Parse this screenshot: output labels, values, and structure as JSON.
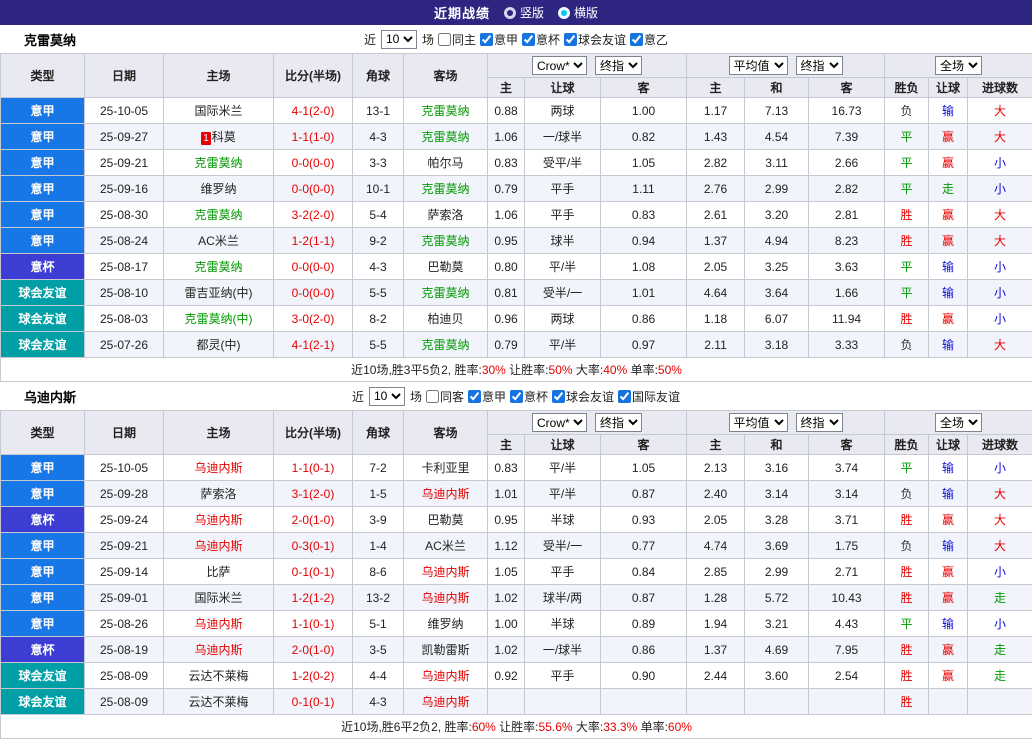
{
  "top_bar": {
    "title": "近期战绩",
    "options": [
      {
        "label": "竖版",
        "selected": false
      },
      {
        "label": "横版",
        "selected": true
      }
    ]
  },
  "table_headers": {
    "cols": [
      "类型",
      "日期",
      "主场",
      "比分(半场)",
      "角球",
      "客场"
    ],
    "groups": [
      {
        "selects": [
          "Crow*",
          "终指"
        ]
      },
      {
        "selects": [
          "平均值",
          "终指"
        ]
      },
      {
        "selects": [
          "全场"
        ]
      }
    ],
    "subs": [
      "主",
      "让球",
      "客",
      "主",
      "和",
      "客",
      "胜负",
      "让球",
      "进球数"
    ]
  },
  "league_colors": {
    "意甲": "#1777e6",
    "意杯": "#3d3dd3",
    "球会友谊": "#009ea5"
  },
  "result_colors": {
    "red": "#e60000",
    "green": "#009900",
    "blue": "#0b0bd6",
    "dark": "#333333"
  },
  "result_keys": {
    "胜": "red",
    "赢": "red",
    "大": "red",
    "平": "green",
    "走": "green",
    "负": "dark",
    "输": "blue",
    "小": "blue"
  },
  "text_colors": {
    "score": "#e60000",
    "opponent": "#222222"
  },
  "tables": [
    {
      "team": "克雷莫纳",
      "team_color": "#009900",
      "filter": {
        "near_label": "近",
        "count": "10",
        "games_label": "场",
        "checks": [
          {
            "label": "同主",
            "checked": false
          },
          {
            "label": "意甲",
            "checked": true
          },
          {
            "label": "意杯",
            "checked": true
          },
          {
            "label": "球会友谊",
            "checked": true
          },
          {
            "label": "意乙",
            "checked": true
          }
        ]
      },
      "rows": [
        {
          "type": "意甲",
          "date": "25-10-05",
          "home": {
            "name": "国际米兰"
          },
          "score": "4-1(2-0)",
          "corners": "13-1",
          "away": {
            "name": "克雷莫纳",
            "self": true
          },
          "odds": [
            "0.88",
            "两球",
            "1.00"
          ],
          "avg": [
            "1.17",
            "7.13",
            "16.73"
          ],
          "results": [
            "负",
            "输",
            "大"
          ]
        },
        {
          "type": "意甲",
          "date": "25-09-27",
          "home": {
            "name": "科莫",
            "badge": "1"
          },
          "score": "1-1(1-0)",
          "corners": "4-3",
          "away": {
            "name": "克雷莫纳",
            "self": true
          },
          "odds": [
            "1.06",
            "一/球半",
            "0.82"
          ],
          "avg": [
            "1.43",
            "4.54",
            "7.39"
          ],
          "results": [
            "平",
            "赢",
            "大"
          ]
        },
        {
          "type": "意甲",
          "date": "25-09-21",
          "home": {
            "name": "克雷莫纳",
            "self": true
          },
          "score": "0-0(0-0)",
          "corners": "3-3",
          "away": {
            "name": "帕尔马"
          },
          "odds": [
            "0.83",
            "受平/半",
            "1.05"
          ],
          "avg": [
            "2.82",
            "3.11",
            "2.66"
          ],
          "results": [
            "平",
            "赢",
            "小"
          ]
        },
        {
          "type": "意甲",
          "date": "25-09-16",
          "home": {
            "name": "维罗纳"
          },
          "score": "0-0(0-0)",
          "corners": "10-1",
          "away": {
            "name": "克雷莫纳",
            "self": true
          },
          "odds": [
            "0.79",
            "平手",
            "1.11"
          ],
          "avg": [
            "2.76",
            "2.99",
            "2.82"
          ],
          "results": [
            "平",
            "走",
            "小"
          ]
        },
        {
          "type": "意甲",
          "date": "25-08-30",
          "home": {
            "name": "克雷莫纳",
            "self": true
          },
          "score": "3-2(2-0)",
          "corners": "5-4",
          "away": {
            "name": "萨索洛"
          },
          "odds": [
            "1.06",
            "平手",
            "0.83"
          ],
          "avg": [
            "2.61",
            "3.20",
            "2.81"
          ],
          "results": [
            "胜",
            "赢",
            "大"
          ]
        },
        {
          "type": "意甲",
          "date": "25-08-24",
          "home": {
            "name": "AC米兰"
          },
          "score": "1-2(1-1)",
          "corners": "9-2",
          "away": {
            "name": "克雷莫纳",
            "self": true
          },
          "odds": [
            "0.95",
            "球半",
            "0.94"
          ],
          "avg": [
            "1.37",
            "4.94",
            "8.23"
          ],
          "results": [
            "胜",
            "赢",
            "大"
          ]
        },
        {
          "type": "意杯",
          "date": "25-08-17",
          "home": {
            "name": "克雷莫纳",
            "self": true
          },
          "score": "0-0(0-0)",
          "corners": "4-3",
          "away": {
            "name": "巴勒莫"
          },
          "odds": [
            "0.80",
            "平/半",
            "1.08"
          ],
          "avg": [
            "2.05",
            "3.25",
            "3.63"
          ],
          "results": [
            "平",
            "输",
            "小"
          ]
        },
        {
          "type": "球会友谊",
          "date": "25-08-10",
          "home": {
            "name": "雷吉亚纳(中)"
          },
          "score": "0-0(0-0)",
          "corners": "5-5",
          "away": {
            "name": "克雷莫纳",
            "self": true
          },
          "odds": [
            "0.81",
            "受半/一",
            "1.01"
          ],
          "avg": [
            "4.64",
            "3.64",
            "1.66"
          ],
          "results": [
            "平",
            "输",
            "小"
          ]
        },
        {
          "type": "球会友谊",
          "date": "25-08-03",
          "home": {
            "name": "克雷莫纳(中)",
            "self": true
          },
          "score": "3-0(2-0)",
          "corners": "8-2",
          "away": {
            "name": "柏迪贝"
          },
          "odds": [
            "0.96",
            "两球",
            "0.86"
          ],
          "avg": [
            "1.18",
            "6.07",
            "11.94"
          ],
          "results": [
            "胜",
            "赢",
            "小"
          ]
        },
        {
          "type": "球会友谊",
          "date": "25-07-26",
          "home": {
            "name": "都灵(中)"
          },
          "score": "4-1(2-1)",
          "corners": "5-5",
          "away": {
            "name": "克雷莫纳",
            "self": true
          },
          "odds": [
            "0.79",
            "平/半",
            "0.97"
          ],
          "avg": [
            "2.11",
            "3.18",
            "3.33"
          ],
          "results": [
            "负",
            "输",
            "大"
          ]
        }
      ],
      "summary": [
        {
          "t": "近10场,胜3平5负2, 胜率:",
          "red": false
        },
        {
          "t": "30%",
          "red": true
        },
        {
          "t": " 让胜率:",
          "red": false
        },
        {
          "t": "50%",
          "red": true
        },
        {
          "t": " 大率:",
          "red": false
        },
        {
          "t": "40%",
          "red": true
        },
        {
          "t": " 单率:",
          "red": false
        },
        {
          "t": "50%",
          "red": true
        }
      ]
    },
    {
      "team": "乌迪内斯",
      "team_color": "#e60000",
      "filter": {
        "near_label": "近",
        "count": "10",
        "games_label": "场",
        "checks": [
          {
            "label": "同客",
            "checked": false
          },
          {
            "label": "意甲",
            "checked": true
          },
          {
            "label": "意杯",
            "checked": true
          },
          {
            "label": "球会友谊",
            "checked": true
          },
          {
            "label": "国际友谊",
            "checked": true
          }
        ]
      },
      "rows": [
        {
          "type": "意甲",
          "date": "25-10-05",
          "home": {
            "name": "乌迪内斯",
            "self": true
          },
          "score": "1-1(0-1)",
          "corners": "7-2",
          "away": {
            "name": "卡利亚里"
          },
          "odds": [
            "0.83",
            "平/半",
            "1.05"
          ],
          "avg": [
            "2.13",
            "3.16",
            "3.74"
          ],
          "results": [
            "平",
            "输",
            "小"
          ]
        },
        {
          "type": "意甲",
          "date": "25-09-28",
          "home": {
            "name": "萨索洛"
          },
          "score": "3-1(2-0)",
          "corners": "1-5",
          "away": {
            "name": "乌迪内斯",
            "self": true
          },
          "odds": [
            "1.01",
            "平/半",
            "0.87"
          ],
          "avg": [
            "2.40",
            "3.14",
            "3.14"
          ],
          "results": [
            "负",
            "输",
            "大"
          ]
        },
        {
          "type": "意杯",
          "date": "25-09-24",
          "home": {
            "name": "乌迪内斯",
            "self": true
          },
          "score": "2-0(1-0)",
          "corners": "3-9",
          "away": {
            "name": "巴勒莫"
          },
          "odds": [
            "0.95",
            "半球",
            "0.93"
          ],
          "avg": [
            "2.05",
            "3.28",
            "3.71"
          ],
          "results": [
            "胜",
            "赢",
            "大"
          ]
        },
        {
          "type": "意甲",
          "date": "25-09-21",
          "home": {
            "name": "乌迪内斯",
            "self": true
          },
          "score": "0-3(0-1)",
          "corners": "1-4",
          "away": {
            "name": "AC米兰"
          },
          "odds": [
            "1.12",
            "受半/一",
            "0.77"
          ],
          "avg": [
            "4.74",
            "3.69",
            "1.75"
          ],
          "results": [
            "负",
            "输",
            "大"
          ]
        },
        {
          "type": "意甲",
          "date": "25-09-14",
          "home": {
            "name": "比萨"
          },
          "score": "0-1(0-1)",
          "corners": "8-6",
          "away": {
            "name": "乌迪内斯",
            "self": true
          },
          "odds": [
            "1.05",
            "平手",
            "0.84"
          ],
          "avg": [
            "2.85",
            "2.99",
            "2.71"
          ],
          "results": [
            "胜",
            "赢",
            "小"
          ]
        },
        {
          "type": "意甲",
          "date": "25-09-01",
          "home": {
            "name": "国际米兰"
          },
          "score": "1-2(1-2)",
          "corners": "13-2",
          "away": {
            "name": "乌迪内斯",
            "self": true
          },
          "odds": [
            "1.02",
            "球半/两",
            "0.87"
          ],
          "avg": [
            "1.28",
            "5.72",
            "10.43"
          ],
          "results": [
            "胜",
            "赢",
            "走"
          ]
        },
        {
          "type": "意甲",
          "date": "25-08-26",
          "home": {
            "name": "乌迪内斯",
            "self": true
          },
          "score": "1-1(0-1)",
          "corners": "5-1",
          "away": {
            "name": "维罗纳"
          },
          "odds": [
            "1.00",
            "半球",
            "0.89"
          ],
          "avg": [
            "1.94",
            "3.21",
            "4.43"
          ],
          "results": [
            "平",
            "输",
            "小"
          ]
        },
        {
          "type": "意杯",
          "date": "25-08-19",
          "home": {
            "name": "乌迪内斯",
            "self": true
          },
          "score": "2-0(1-0)",
          "corners": "3-5",
          "away": {
            "name": "凯勒雷斯"
          },
          "odds": [
            "1.02",
            "一/球半",
            "0.86"
          ],
          "avg": [
            "1.37",
            "4.69",
            "7.95"
          ],
          "results": [
            "胜",
            "赢",
            "走"
          ]
        },
        {
          "type": "球会友谊",
          "date": "25-08-09",
          "home": {
            "name": "云达不莱梅"
          },
          "score": "1-2(0-2)",
          "corners": "4-4",
          "away": {
            "name": "乌迪内斯",
            "self": true
          },
          "odds": [
            "0.92",
            "平手",
            "0.90"
          ],
          "avg": [
            "2.44",
            "3.60",
            "2.54"
          ],
          "results": [
            "胜",
            "赢",
            "走"
          ]
        },
        {
          "type": "球会友谊",
          "date": "25-08-09",
          "home": {
            "name": "云达不莱梅"
          },
          "score": "0-1(0-1)",
          "corners": "4-3",
          "away": {
            "name": "乌迪内斯",
            "self": true
          },
          "odds": [
            "",
            "",
            ""
          ],
          "avg": [
            "",
            "",
            ""
          ],
          "results": [
            "胜",
            "",
            ""
          ]
        }
      ],
      "summary": [
        {
          "t": "近10场,胜6平2负2, 胜率:",
          "red": false
        },
        {
          "t": "60%",
          "red": true
        },
        {
          "t": " 让胜率:",
          "red": false
        },
        {
          "t": "55.6%",
          "red": true
        },
        {
          "t": " 大率:",
          "red": false
        },
        {
          "t": "33.3%",
          "red": true
        },
        {
          "t": " 单率:",
          "red": false
        },
        {
          "t": "60%",
          "red": true
        }
      ]
    }
  ]
}
